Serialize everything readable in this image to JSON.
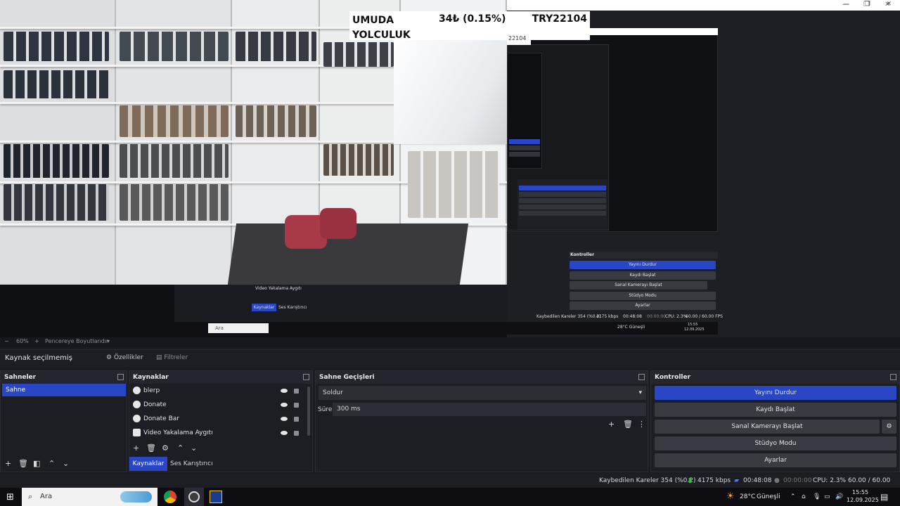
{
  "overlay": {
    "ticker_name": "UMUDA\nYOLCULUK",
    "ticker_price": "34₺ (0.15%)",
    "ticker_code": "TRY22104",
    "ticker_code_sub": "22104"
  },
  "window_controls": {
    "minimize": "—",
    "restore": "❐",
    "close": "✕"
  },
  "nested": {
    "kontroller_title": "Kontroller",
    "yayini_durdur": "Yayını Durdur",
    "kaydi_baslat": "Kaydı Başlat",
    "sanal_kamera": "Sanal Kamerayı Başlat",
    "studyo": "Stüdyo Modu",
    "ayarlar": "Ayarlar",
    "source_item": "Video Yakalama Aygıtı",
    "tab_kaynaklar": "Kaynaklar",
    "tab_ses": "Ses Karıştırıcı",
    "status": "Kaybedilen Kareler 354 (%0.2)",
    "kbps": "4175 kbps",
    "time": "00:48:08",
    "rec_time": "00:00:00",
    "cpu": "CPU: 2.3%",
    "fps": "60.00 / 60.00 FPS",
    "search": "Ara",
    "weather": "28°C  Güneşli",
    "clock_time": "15:55",
    "clock_date": "12.09.2025"
  },
  "zoom_bar": {
    "minus": "−",
    "zoom": "60%",
    "plus": "+",
    "fit": "Pencereye Boyutlandır",
    "caret": "▾"
  },
  "props_bar": {
    "no_source": "Kaynak seçilmemiş",
    "properties": "Özellikler",
    "filters": "Filtreler"
  },
  "scenes": {
    "title": "Sahneler",
    "items": [
      "Sahne"
    ]
  },
  "sources": {
    "title": "Kaynaklar",
    "items": [
      "blerp",
      "Donate",
      "Donate Bar",
      "Video Yakalama Aygıtı"
    ],
    "tab_sources": "Kaynaklar",
    "tab_audio": "Ses Karıştırıcı"
  },
  "transitions": {
    "title": "Sahne Geçişleri",
    "selected": "Soldur",
    "duration_label": "Süre",
    "duration_value": "300 ms"
  },
  "controls": {
    "title": "Kontroller",
    "stop_stream": "Yayını Durdur",
    "start_record": "Kaydı Başlat",
    "start_virtual_cam": "Sanal Kamerayı Başlat",
    "studio_mode": "Stüdyo Modu",
    "settings": "Ayarlar"
  },
  "status": {
    "dropped_frames": "Kaybedilen Kareler 354 (%0.2)",
    "bitrate": "4175 kbps",
    "stream_time": "00:48:08",
    "record_time": "00:00:00",
    "cpu": "CPU: 2.3%",
    "fps": "60.00 / 60.00 FPS"
  },
  "taskbar": {
    "search_placeholder": "Ara",
    "weather": "28°C",
    "weather_text": "Güneşli",
    "time": "15:55",
    "date": "12.09.2025"
  },
  "colors": {
    "accent": "#2846c5",
    "panel": "#1d1e24",
    "taskbar": "#0e0e12"
  }
}
